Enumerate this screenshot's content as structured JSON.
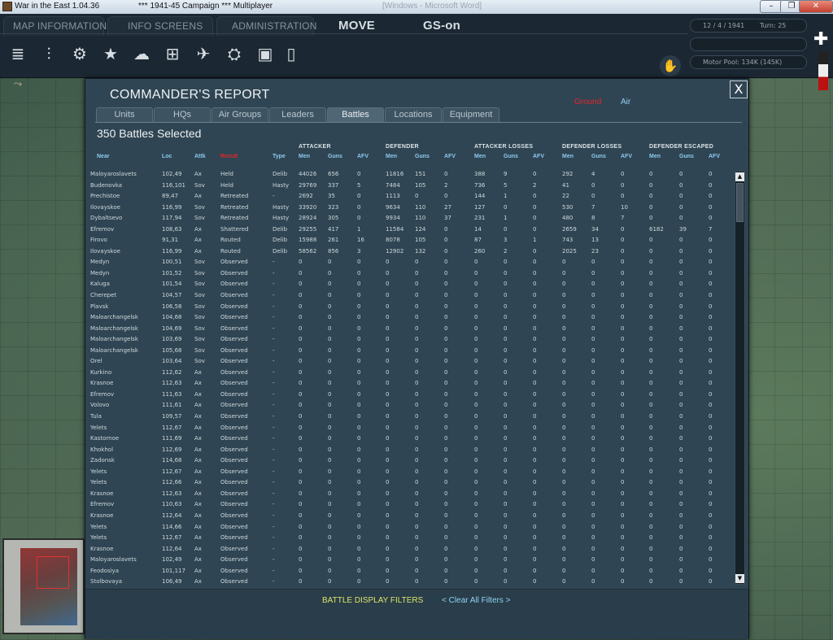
{
  "window": {
    "title": "War in the East 1.04.36",
    "campaign": "***    1941-45 Campaign    ***    Multiplayer",
    "center_title": "[Windows - Microsoft Word]",
    "minimize": "–",
    "restore": "❐",
    "close": "✕"
  },
  "topbar": {
    "menus": [
      "MAP INFORMATION",
      "INFO SCREENS",
      "ADMINISTRATION"
    ],
    "mode": "MOVE",
    "gs": "GS-on",
    "date": "12 / 4 / 1941",
    "turn": "Turn: 25",
    "motor_pool": "Motor Pool: 134K (145K)",
    "toolbar_icons": [
      "layers-icon",
      "unit-bars-icon",
      "gear-icon",
      "star-icon",
      "weather-icon",
      "grid-icon",
      "air-icon",
      "rail-icon",
      "supply-icon",
      "doc-icon"
    ],
    "subtoolbar_icons": [
      "path-icon",
      "rail-unit-icon",
      "ship-icon"
    ]
  },
  "report": {
    "title": "COMMANDER'S REPORT",
    "close": "X",
    "toggle_ground": "Ground",
    "toggle_air": "Air",
    "tabs": [
      "Units",
      "HQs",
      "Air Groups",
      "Leaders",
      "Battles",
      "Locations",
      "Equipment"
    ],
    "active_tab": "Battles",
    "selected": "350 Battles Selected",
    "groups": [
      "ATTACKER",
      "DEFENDER",
      "ATTACKER LOSSES",
      "DEFENDER LOSSES",
      "DEFENDER ESCAPED"
    ],
    "columns": [
      "Near",
      "Loc",
      "Attk",
      "Result",
      "Type",
      "Men",
      "Guns",
      "AFV",
      "Men",
      "Guns",
      "AFV",
      "Men",
      "Guns",
      "AFV",
      "Men",
      "Guns",
      "AFV",
      "Men",
      "Guns",
      "AFV"
    ],
    "rows": [
      [
        "Maloyaroslavets",
        "102,49",
        "Ax",
        "Held",
        "Delib",
        "44026",
        "656",
        "0",
        "11816",
        "151",
        "0",
        "388",
        "9",
        "0",
        "292",
        "4",
        "0",
        "0",
        "0",
        "0"
      ],
      [
        "Budenovka",
        "116,101",
        "Sov",
        "Held",
        "Hasty",
        "29769",
        "337",
        "5",
        "7484",
        "105",
        "2",
        "736",
        "5",
        "2",
        "41",
        "0",
        "0",
        "0",
        "0",
        "0"
      ],
      [
        "Prechistoe",
        "89,47",
        "Ax",
        "Retreated",
        "-",
        "2692",
        "35",
        "0",
        "1113",
        "0",
        "0",
        "144",
        "1",
        "0",
        "22",
        "0",
        "0",
        "0",
        "0",
        "0"
      ],
      [
        "Ilovayskoe",
        "116,99",
        "Sov",
        "Retreated",
        "Hasty",
        "33920",
        "323",
        "0",
        "9634",
        "110",
        "27",
        "127",
        "0",
        "0",
        "530",
        "7",
        "10",
        "0",
        "0",
        "0"
      ],
      [
        "Dybaltsevo",
        "117,94",
        "Sov",
        "Retreated",
        "Hasty",
        "28924",
        "305",
        "0",
        "9934",
        "110",
        "37",
        "231",
        "1",
        "0",
        "480",
        "8",
        "7",
        "0",
        "0",
        "0"
      ],
      [
        "Efremov",
        "108,63",
        "Ax",
        "Shattered",
        "Delib",
        "29255",
        "417",
        "1",
        "11584",
        "124",
        "0",
        "14",
        "0",
        "0",
        "2659",
        "34",
        "0",
        "6182",
        "39",
        "7"
      ],
      [
        "Firovo",
        "91,31",
        "Ax",
        "Routed",
        "Delib",
        "15988",
        "261",
        "16",
        "8078",
        "105",
        "0",
        "87",
        "3",
        "1",
        "743",
        "13",
        "0",
        "0",
        "0",
        "0"
      ],
      [
        "Ilovayskoe",
        "116,99",
        "Ax",
        "Routed",
        "Delib",
        "58562",
        "856",
        "3",
        "12902",
        "132",
        "0",
        "260",
        "2",
        "0",
        "2025",
        "23",
        "0",
        "0",
        "0",
        "0"
      ],
      [
        "Medyn",
        "100,51",
        "Sov",
        "Observed",
        "-",
        "0",
        "0",
        "0",
        "0",
        "0",
        "0",
        "0",
        "0",
        "0",
        "0",
        "0",
        "0",
        "0",
        "0",
        "0"
      ],
      [
        "Medyn",
        "101,52",
        "Sov",
        "Observed",
        "-",
        "0",
        "0",
        "0",
        "0",
        "0",
        "0",
        "0",
        "0",
        "0",
        "0",
        "0",
        "0",
        "0",
        "0",
        "0"
      ],
      [
        "Kaluga",
        "101,54",
        "Sov",
        "Observed",
        "-",
        "0",
        "0",
        "0",
        "0",
        "0",
        "0",
        "0",
        "0",
        "0",
        "0",
        "0",
        "0",
        "0",
        "0",
        "0"
      ],
      [
        "Cherepet",
        "104,57",
        "Sov",
        "Observed",
        "-",
        "0",
        "0",
        "0",
        "0",
        "0",
        "0",
        "0",
        "0",
        "0",
        "0",
        "0",
        "0",
        "0",
        "0",
        "0"
      ],
      [
        "Plavsk",
        "106,58",
        "Sov",
        "Observed",
        "-",
        "0",
        "0",
        "0",
        "0",
        "0",
        "0",
        "0",
        "0",
        "0",
        "0",
        "0",
        "0",
        "0",
        "0",
        "0"
      ],
      [
        "Maloarchangelsk",
        "104,68",
        "Sov",
        "Observed",
        "-",
        "0",
        "0",
        "0",
        "0",
        "0",
        "0",
        "0",
        "0",
        "0",
        "0",
        "0",
        "0",
        "0",
        "0",
        "0"
      ],
      [
        "Maloarchangelsk",
        "104,69",
        "Sov",
        "Observed",
        "-",
        "0",
        "0",
        "0",
        "0",
        "0",
        "0",
        "0",
        "0",
        "0",
        "0",
        "0",
        "0",
        "0",
        "0",
        "0"
      ],
      [
        "Maloarchangelsk",
        "103,69",
        "Sov",
        "Observed",
        "-",
        "0",
        "0",
        "0",
        "0",
        "0",
        "0",
        "0",
        "0",
        "0",
        "0",
        "0",
        "0",
        "0",
        "0",
        "0"
      ],
      [
        "Maloarchangelsk",
        "105,68",
        "Sov",
        "Observed",
        "-",
        "0",
        "0",
        "0",
        "0",
        "0",
        "0",
        "0",
        "0",
        "0",
        "0",
        "0",
        "0",
        "0",
        "0",
        "0"
      ],
      [
        "Orel",
        "103,64",
        "Sov",
        "Observed",
        "-",
        "0",
        "0",
        "0",
        "0",
        "0",
        "0",
        "0",
        "0",
        "0",
        "0",
        "0",
        "0",
        "0",
        "0",
        "0"
      ],
      [
        "Kurkino",
        "112,62",
        "Ax",
        "Observed",
        "-",
        "0",
        "0",
        "0",
        "0",
        "0",
        "0",
        "0",
        "0",
        "0",
        "0",
        "0",
        "0",
        "0",
        "0",
        "0"
      ],
      [
        "Krasnoe",
        "112,63",
        "Ax",
        "Observed",
        "-",
        "0",
        "0",
        "0",
        "0",
        "0",
        "0",
        "0",
        "0",
        "0",
        "0",
        "0",
        "0",
        "0",
        "0",
        "0"
      ],
      [
        "Efremov",
        "111,63",
        "Ax",
        "Observed",
        "-",
        "0",
        "0",
        "0",
        "0",
        "0",
        "0",
        "0",
        "0",
        "0",
        "0",
        "0",
        "0",
        "0",
        "0",
        "0"
      ],
      [
        "Volovo",
        "111,61",
        "Ax",
        "Observed",
        "-",
        "0",
        "0",
        "0",
        "0",
        "0",
        "0",
        "0",
        "0",
        "0",
        "0",
        "0",
        "0",
        "0",
        "0",
        "0"
      ],
      [
        "Tula",
        "109,57",
        "Ax",
        "Observed",
        "-",
        "0",
        "0",
        "0",
        "0",
        "0",
        "0",
        "0",
        "0",
        "0",
        "0",
        "0",
        "0",
        "0",
        "0",
        "0"
      ],
      [
        "Yelets",
        "112,67",
        "Ax",
        "Observed",
        "-",
        "0",
        "0",
        "0",
        "0",
        "0",
        "0",
        "0",
        "0",
        "0",
        "0",
        "0",
        "0",
        "0",
        "0",
        "0"
      ],
      [
        "Kastornoe",
        "111,69",
        "Ax",
        "Observed",
        "-",
        "0",
        "0",
        "0",
        "0",
        "0",
        "0",
        "0",
        "0",
        "0",
        "0",
        "0",
        "0",
        "0",
        "0",
        "0"
      ],
      [
        "Khokhol",
        "112,69",
        "Ax",
        "Observed",
        "-",
        "0",
        "0",
        "0",
        "0",
        "0",
        "0",
        "0",
        "0",
        "0",
        "0",
        "0",
        "0",
        "0",
        "0",
        "0"
      ],
      [
        "Zadonsk",
        "114,68",
        "Ax",
        "Observed",
        "-",
        "0",
        "0",
        "0",
        "0",
        "0",
        "0",
        "0",
        "0",
        "0",
        "0",
        "0",
        "0",
        "0",
        "0",
        "0"
      ],
      [
        "Yelets",
        "112,67",
        "Ax",
        "Observed",
        "-",
        "0",
        "0",
        "0",
        "0",
        "0",
        "0",
        "0",
        "0",
        "0",
        "0",
        "0",
        "0",
        "0",
        "0",
        "0"
      ],
      [
        "Yelets",
        "112,66",
        "Ax",
        "Observed",
        "-",
        "0",
        "0",
        "0",
        "0",
        "0",
        "0",
        "0",
        "0",
        "0",
        "0",
        "0",
        "0",
        "0",
        "0",
        "0"
      ],
      [
        "Krasnoe",
        "112,63",
        "Ax",
        "Observed",
        "-",
        "0",
        "0",
        "0",
        "0",
        "0",
        "0",
        "0",
        "0",
        "0",
        "0",
        "0",
        "0",
        "0",
        "0",
        "0"
      ],
      [
        "Efremov",
        "110,63",
        "Ax",
        "Observed",
        "-",
        "0",
        "0",
        "0",
        "0",
        "0",
        "0",
        "0",
        "0",
        "0",
        "0",
        "0",
        "0",
        "0",
        "0",
        "0"
      ],
      [
        "Krasnoe",
        "112,64",
        "Ax",
        "Observed",
        "-",
        "0",
        "0",
        "0",
        "0",
        "0",
        "0",
        "0",
        "0",
        "0",
        "0",
        "0",
        "0",
        "0",
        "0",
        "0"
      ],
      [
        "Yelets",
        "114,66",
        "Ax",
        "Observed",
        "-",
        "0",
        "0",
        "0",
        "0",
        "0",
        "0",
        "0",
        "0",
        "0",
        "0",
        "0",
        "0",
        "0",
        "0",
        "0"
      ],
      [
        "Yelets",
        "112,67",
        "Ax",
        "Observed",
        "-",
        "0",
        "0",
        "0",
        "0",
        "0",
        "0",
        "0",
        "0",
        "0",
        "0",
        "0",
        "0",
        "0",
        "0",
        "0"
      ],
      [
        "Krasnoe",
        "112,64",
        "Ax",
        "Observed",
        "-",
        "0",
        "0",
        "0",
        "0",
        "0",
        "0",
        "0",
        "0",
        "0",
        "0",
        "0",
        "0",
        "0",
        "0",
        "0"
      ],
      [
        "Maloyaroslavets",
        "102,49",
        "Ax",
        "Observed",
        "-",
        "0",
        "0",
        "0",
        "0",
        "0",
        "0",
        "0",
        "0",
        "0",
        "0",
        "0",
        "0",
        "0",
        "0",
        "0"
      ],
      [
        "Feodosiya",
        "101,117",
        "Ax",
        "Observed",
        "-",
        "0",
        "0",
        "0",
        "0",
        "0",
        "0",
        "0",
        "0",
        "0",
        "0",
        "0",
        "0",
        "0",
        "0",
        "0"
      ],
      [
        "Stolbovaya",
        "106,49",
        "Ax",
        "Observed",
        "-",
        "0",
        "0",
        "0",
        "0",
        "0",
        "0",
        "0",
        "0",
        "0",
        "0",
        "0",
        "0",
        "0",
        "0",
        "0"
      ]
    ],
    "scroll_up": "▲",
    "scroll_down": "▼",
    "filters_label": "BATTLE DISPLAY FILTERS",
    "clear_label": "< Clear All Filters >"
  }
}
